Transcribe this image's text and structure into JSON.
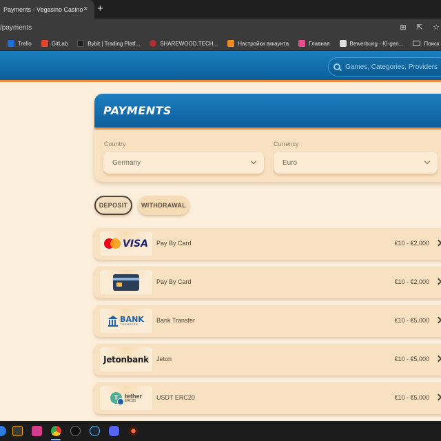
{
  "browser": {
    "tab_title": "Payments - Vegasino Casino",
    "tab_close": "×",
    "new_tab": "+",
    "url": "/payments",
    "bookmarks": [
      {
        "label": "Trello",
        "color": "#1e6fd9"
      },
      {
        "label": "GitLab",
        "color": "#e2432a"
      },
      {
        "label": "Bybit | Trading Platf...",
        "color": "#202020"
      },
      {
        "label": "SHAREWOOD.TECH...",
        "color": "#b03030"
      },
      {
        "label": "Настройки аккаунта",
        "color": "#f08a24"
      },
      {
        "label": "Главная",
        "color": "#e94b8c"
      },
      {
        "label": "Bewerbung - KI-gen...",
        "color": "#dddddd"
      },
      {
        "label": "Поиск работы",
        "color": ""
      }
    ]
  },
  "header": {
    "search_placeholder": "Games, Categories, Providers"
  },
  "payments": {
    "title": "PAYMENTS",
    "country_label": "Country",
    "country_value": "Germany",
    "currency_label": "Currency",
    "currency_value": "Euro",
    "tabs": [
      {
        "label": "DEPOSIT",
        "active": true
      },
      {
        "label": "WITHDRAWAL",
        "active": false
      }
    ],
    "methods": [
      {
        "name": "Pay By Card",
        "range": "€10 - €2,000",
        "logo": "mastercard-visa",
        "logo_text": "VISA"
      },
      {
        "name": "Pay By Card",
        "range": "€10 - €2,000",
        "logo": "credit-card"
      },
      {
        "name": "Bank Transfer",
        "range": "€10 - €5,000",
        "logo": "bank",
        "logo_text": "BANK",
        "logo_subtext": "TRANSFER"
      },
      {
        "name": "Jeton",
        "range": "€10 - €5,000",
        "logo": "jetonbank",
        "logo_text": "Jetonbank"
      },
      {
        "name": "USDT ERC20",
        "range": "€10 - €5,000",
        "logo": "tether",
        "logo_text": "tether",
        "logo_subtext": "ERC20"
      }
    ]
  },
  "colors": {
    "header_blue": "#1a7fbf",
    "accent_orange": "#f08a3b",
    "page_bg": "#fbeedb"
  }
}
